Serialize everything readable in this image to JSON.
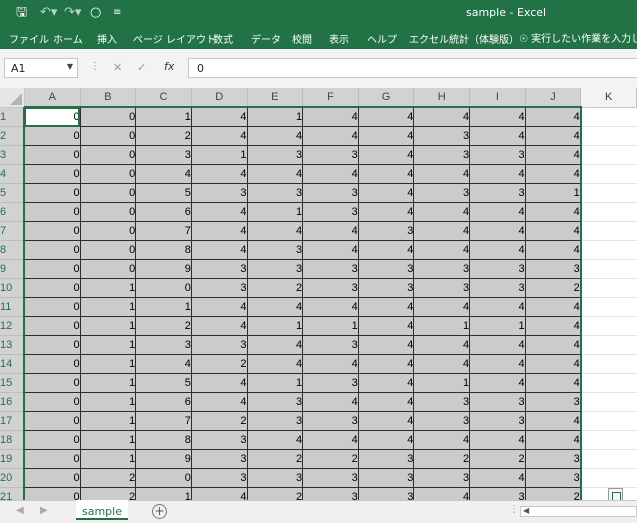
{
  "titlebar": {
    "title": "sample  -  Excel",
    "icons": [
      "save-icon",
      "undo-icon",
      "redo-icon",
      "circle-icon",
      "customize-icon"
    ]
  },
  "ribbon": {
    "tabs": [
      "ファイル",
      "ホーム",
      "挿入",
      "ページ レイアウト",
      "数式",
      "データ",
      "校閲",
      "表示",
      "ヘルプ",
      "エクセル統計（体験版）"
    ],
    "tell_me": "実行したい作業を入力して"
  },
  "formula_bar": {
    "name_box": "A1",
    "fx_label": "fx",
    "formula": "0"
  },
  "columns": [
    "A",
    "B",
    "C",
    "D",
    "E",
    "F",
    "G",
    "H",
    "I",
    "J",
    "K"
  ],
  "rows": [
    {
      "n": "1",
      "cells": [
        0,
        0,
        1,
        4,
        1,
        4,
        4,
        4,
        4,
        4
      ]
    },
    {
      "n": "2",
      "cells": [
        0,
        0,
        2,
        4,
        4,
        4,
        4,
        3,
        4,
        4
      ]
    },
    {
      "n": "3",
      "cells": [
        0,
        0,
        3,
        1,
        3,
        3,
        4,
        3,
        3,
        4
      ]
    },
    {
      "n": "4",
      "cells": [
        0,
        0,
        4,
        4,
        4,
        4,
        4,
        4,
        4,
        4
      ]
    },
    {
      "n": "5",
      "cells": [
        0,
        0,
        5,
        3,
        3,
        3,
        4,
        3,
        3,
        1
      ]
    },
    {
      "n": "6",
      "cells": [
        0,
        0,
        6,
        4,
        1,
        3,
        4,
        4,
        4,
        4
      ]
    },
    {
      "n": "7",
      "cells": [
        0,
        0,
        7,
        4,
        4,
        4,
        3,
        4,
        4,
        4
      ]
    },
    {
      "n": "8",
      "cells": [
        0,
        0,
        8,
        4,
        3,
        4,
        4,
        4,
        4,
        4
      ]
    },
    {
      "n": "9",
      "cells": [
        0,
        0,
        9,
        3,
        3,
        3,
        3,
        3,
        3,
        3
      ]
    },
    {
      "n": "10",
      "cells": [
        0,
        1,
        0,
        3,
        2,
        3,
        3,
        3,
        3,
        2
      ]
    },
    {
      "n": "11",
      "cells": [
        0,
        1,
        1,
        4,
        4,
        4,
        4,
        4,
        4,
        4
      ]
    },
    {
      "n": "12",
      "cells": [
        0,
        1,
        2,
        4,
        1,
        1,
        4,
        1,
        1,
        4
      ]
    },
    {
      "n": "13",
      "cells": [
        0,
        1,
        3,
        3,
        4,
        3,
        4,
        4,
        4,
        4
      ]
    },
    {
      "n": "14",
      "cells": [
        0,
        1,
        4,
        2,
        4,
        4,
        4,
        4,
        4,
        4
      ]
    },
    {
      "n": "15",
      "cells": [
        0,
        1,
        5,
        4,
        1,
        3,
        4,
        1,
        4,
        4
      ]
    },
    {
      "n": "16",
      "cells": [
        0,
        1,
        6,
        4,
        3,
        4,
        4,
        3,
        3,
        3
      ]
    },
    {
      "n": "17",
      "cells": [
        0,
        1,
        7,
        2,
        3,
        3,
        4,
        3,
        3,
        4
      ]
    },
    {
      "n": "18",
      "cells": [
        0,
        1,
        8,
        3,
        4,
        4,
        4,
        4,
        4,
        4
      ]
    },
    {
      "n": "19",
      "cells": [
        0,
        1,
        9,
        3,
        2,
        2,
        3,
        2,
        2,
        3
      ]
    },
    {
      "n": "20",
      "cells": [
        0,
        2,
        0,
        3,
        3,
        3,
        3,
        3,
        4,
        3
      ]
    },
    {
      "n": "21",
      "cells": [
        0,
        2,
        1,
        4,
        2,
        3,
        3,
        4,
        3,
        2
      ]
    }
  ],
  "sheet_tabs": {
    "tabs": [
      "sample"
    ],
    "add_label": "+"
  }
}
